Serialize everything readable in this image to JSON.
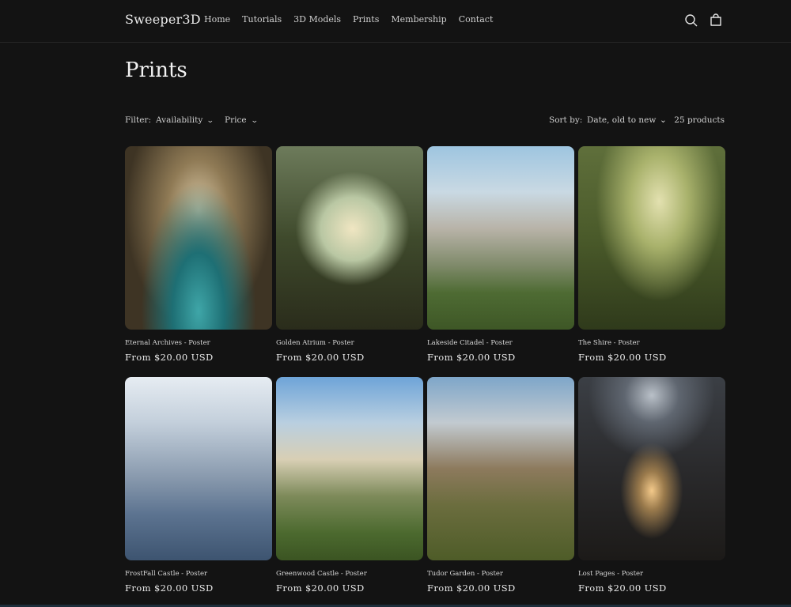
{
  "header": {
    "logo": "Sweeper3D",
    "nav": [
      "Home",
      "Tutorials",
      "3D Models",
      "Prints",
      "Membership",
      "Contact"
    ],
    "icons": [
      "search-icon",
      "cart-icon"
    ]
  },
  "page": {
    "title": "Prints"
  },
  "filters": {
    "label": "Filter:",
    "availability": "Availability",
    "price": "Price",
    "sort_label": "Sort by:",
    "sort_value": "Date, old to new",
    "count": "25 products"
  },
  "products": [
    {
      "title": "Eternal Archives - Poster",
      "price": "From $20.00 USD"
    },
    {
      "title": "Golden Atrium - Poster",
      "price": "From $20.00 USD"
    },
    {
      "title": "Lakeside Citadel - Poster",
      "price": "From $20.00 USD"
    },
    {
      "title": "The Shire - Poster",
      "price": "From $20.00 USD"
    },
    {
      "title": "FrostFall Castle - Poster",
      "price": "From $20.00 USD"
    },
    {
      "title": "Greenwood Castle - Poster",
      "price": "From $20.00 USD"
    },
    {
      "title": "Tudor Garden - Poster",
      "price": "From $20.00 USD"
    },
    {
      "title": "Lost Pages - Poster",
      "price": "From $20.00 USD"
    }
  ]
}
